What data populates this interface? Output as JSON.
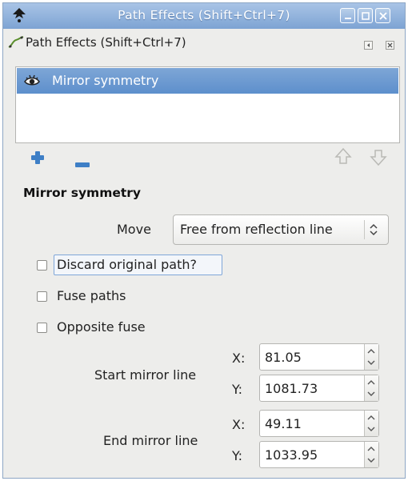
{
  "window": {
    "title": "Path Effects  (Shift+Ctrl+7)",
    "buttons": [
      "minimize",
      "maximize",
      "close"
    ]
  },
  "dock": {
    "title": "Path Effects  (Shift+Ctrl+7)"
  },
  "effects_list": {
    "items": [
      {
        "label": "Mirror symmetry",
        "visible": true,
        "selected": true
      }
    ]
  },
  "toolbar": {
    "icons": [
      "add-icon",
      "remove-icon",
      "move-up-icon",
      "move-down-icon"
    ]
  },
  "effect_settings": {
    "title": "Mirror symmetry",
    "move_label": "Move",
    "move_value": "Free from reflection line",
    "checkboxes": [
      {
        "label": "Discard original path?",
        "checked": false,
        "focused": true
      },
      {
        "label": "Fuse paths",
        "checked": false
      },
      {
        "label": "Opposite fuse",
        "checked": false
      }
    ],
    "start_line": {
      "label": "Start mirror line",
      "x_label": "X:",
      "x_value": "81.05",
      "y_label": "Y:",
      "y_value": "1081.73"
    },
    "end_line": {
      "label": "End mirror line",
      "x_label": "X:",
      "x_value": "49.11",
      "y_label": "Y:",
      "y_value": "1033.95"
    }
  },
  "colors": {
    "titlebar": "#7da3d3",
    "selection": "#5d8fcc",
    "add_icon": "#3e7fc6",
    "remove_icon": "#3e7fc6"
  }
}
